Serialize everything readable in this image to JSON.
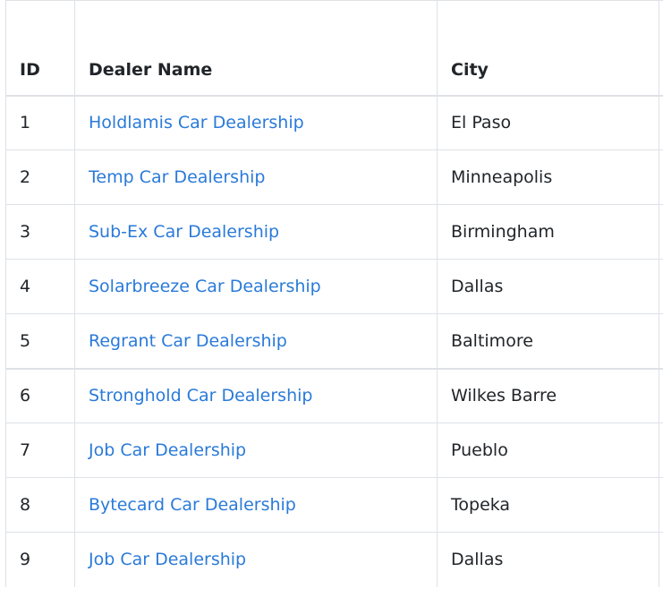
{
  "table": {
    "headers": {
      "id": "ID",
      "name": "Dealer Name",
      "city": "City"
    },
    "rows": [
      {
        "id": "1",
        "name": "Holdlamis Car Dealership",
        "city": "El Paso"
      },
      {
        "id": "2",
        "name": "Temp Car Dealership",
        "city": "Minneapolis"
      },
      {
        "id": "3",
        "name": "Sub-Ex Car Dealership",
        "city": "Birmingham"
      },
      {
        "id": "4",
        "name": "Solarbreeze Car Dealership",
        "city": "Dallas"
      },
      {
        "id": "5",
        "name": "Regrant Car Dealership",
        "city": "Baltimore"
      },
      {
        "id": "6",
        "name": "Stronghold Car Dealership",
        "city": "Wilkes Barre"
      },
      {
        "id": "7",
        "name": "Job Car Dealership",
        "city": "Pueblo"
      },
      {
        "id": "8",
        "name": "Bytecard Car Dealership",
        "city": "Topeka"
      },
      {
        "id": "9",
        "name": "Job Car Dealership",
        "city": "Dallas"
      }
    ]
  },
  "colors": {
    "link": "#2a7ad9",
    "text": "#212529",
    "border": "#dee2e6"
  }
}
